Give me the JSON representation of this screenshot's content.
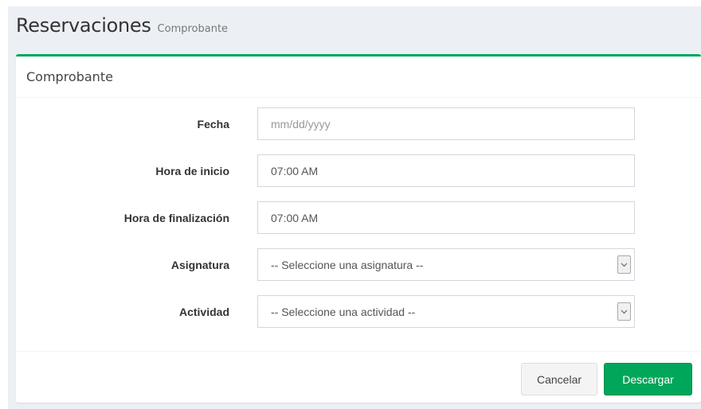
{
  "header": {
    "title": "Reservaciones",
    "subtitle": "Comprobante"
  },
  "box": {
    "title": "Comprobante"
  },
  "form": {
    "fecha": {
      "label": "Fecha",
      "placeholder": "mm/dd/yyyy"
    },
    "hora_inicio": {
      "label": "Hora de inicio",
      "value": "07:00 AM"
    },
    "hora_fin": {
      "label": "Hora de finalización",
      "value": "07:00 AM"
    },
    "asignatura": {
      "label": "Asignatura",
      "selected": "-- Seleccione una asignatura --"
    },
    "actividad": {
      "label": "Actividad",
      "selected": "-- Seleccione una actividad --"
    }
  },
  "footer": {
    "cancel_label": "Cancelar",
    "download_label": "Descargar"
  },
  "colors": {
    "accent": "#00a65a",
    "background": "#ecf0f5"
  },
  "icons": {
    "select_arrow": "chevron-down-icon"
  }
}
